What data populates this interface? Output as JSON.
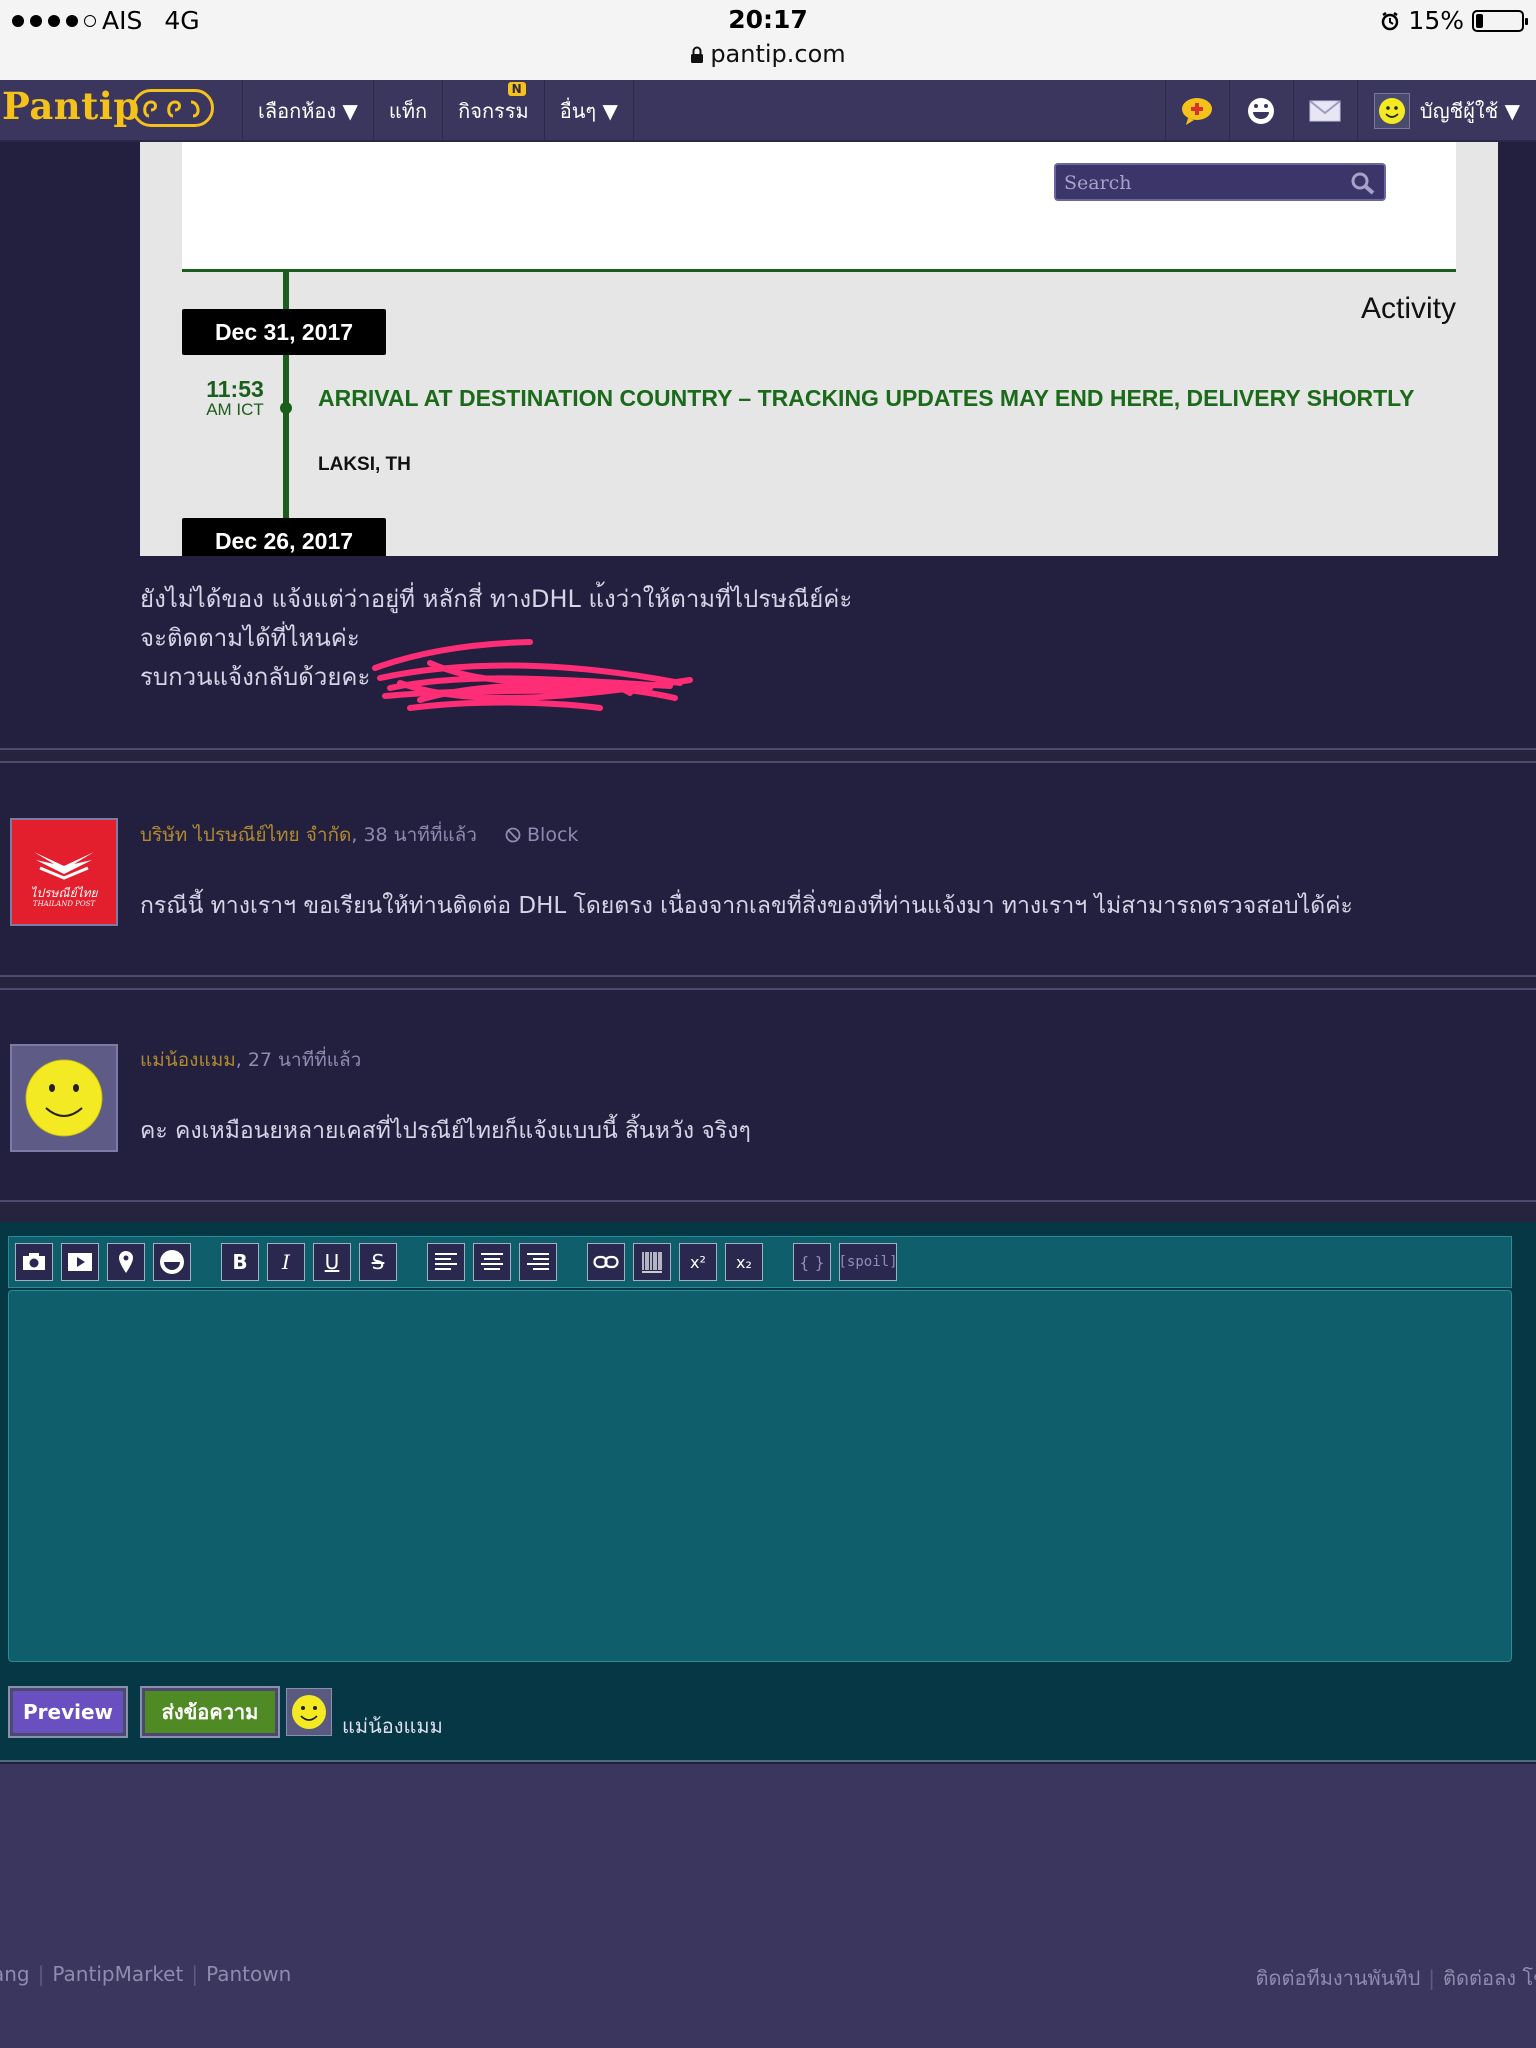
{
  "status_bar": {
    "carrier": "AIS",
    "network": "4G",
    "time": "20:17",
    "battery": "15%",
    "battery_level": 0.15,
    "url": "pantip.com"
  },
  "navbar": {
    "logo": "Pantip",
    "items": [
      {
        "label": "เลือกห้อง ▼"
      },
      {
        "label": "แท็ก"
      },
      {
        "label": "กิจกรรม",
        "badge": "N"
      },
      {
        "label": "อื่นๆ ▼"
      }
    ],
    "icons": [
      "chat-add-icon",
      "emoticon-icon",
      "mail-icon"
    ],
    "user_label": "บัญชีผู้ใช้ ▼"
  },
  "tracking": {
    "search_placeholder": "Search",
    "activity_heading": "Activity",
    "date1": "Dec 31, 2017",
    "time": "11:53",
    "time_zone": "AM ICT",
    "event_title": "ARRIVAL AT DESTINATION COUNTRY – TRACKING UPDATES MAY END HERE, DELIVERY SHORTLY",
    "event_location": "LAKSI, TH",
    "date2": "Dec 26, 2017"
  },
  "post": {
    "lines": [
      "ยังไม่ได้ของ แจ้งแต่ว่าอยู่ที่ หลักสี่ ทางDHL แ้งว่าให้ตามที่ไปรษณีย์ค่ะ",
      "จะติดตามได้ที่ไหนค่ะ",
      "รบกวนแจ้งกลับด้วยคะ"
    ]
  },
  "comments": [
    {
      "author": "บริษัท ไปรษณีย์ไทย จำกัด",
      "time": ", 38 นาทีที่แล้ว",
      "block_label": "Block",
      "body": "กรณีนี้ ทางเราฯ ขอเรียนให้ท่านติดต่อ DHL โดยตรง เนื่องจากเลขที่สิ่งของที่ท่านแจ้งมา ทางเราฯ ไม่สามารถตรวจสอบได้ค่ะ",
      "avatar_text": "ไปรษณีย์ไทย",
      "avatar_subtext": "THAILAND POST"
    },
    {
      "author": "แม่น้องแมม",
      "time": ", 27 นาทีที่แล้ว",
      "body": "คะ คงเหมือนยหลายเคสที่ไปรณีย์ไทยก็แจ้งแบบนี้ สิ้นหวัง จริงๆ"
    }
  ],
  "editor": {
    "toolbar": [
      "camera-icon",
      "youtube-icon",
      "map-pin-icon",
      "emoticon-icon",
      "B",
      "I",
      "U",
      "S",
      "align-left-icon",
      "align-center-icon",
      "align-right-icon",
      "link-icon",
      "barcode-icon",
      "x²",
      "x₂",
      "{ }",
      "[spoil]"
    ],
    "preview_label": "Preview",
    "send_label": "ส่งข้อความ",
    "username": "แม่น้องแมม"
  },
  "footer": {
    "left": [
      "ang",
      "PantipMarket",
      "Pantown"
    ],
    "right": [
      "ติดต่อทีมงานพันทิป",
      "ติดต่อลง โฆ"
    ]
  },
  "colors": {
    "page_bg": "#23203f",
    "nav_bg": "#3b365e",
    "logo": "#f5c21b",
    "tracking_green": "#1b6a1b",
    "editor_bg": "#063745",
    "preview_btn": "#6a4fc0",
    "send_btn": "#4f8a25",
    "author_name": "#b08a2e"
  }
}
